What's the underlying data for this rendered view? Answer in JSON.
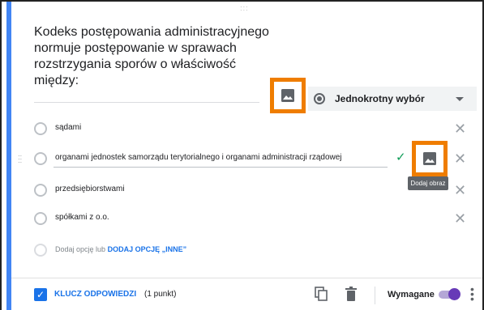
{
  "question": {
    "text": "Kodeks postępowania administracyjnego\nnormuje postępowanie w sprawach\nrozstrzygania sporów o właściwość\nmiędzy:",
    "type_label": "Jednokrotny wybór"
  },
  "options": [
    {
      "label": "sądami"
    },
    {
      "label": "organami jednostek samorządu terytorialnego i organami administracji rządowej"
    },
    {
      "label": "przedsiębiorstwami"
    },
    {
      "label": "spółkami z o.o."
    }
  ],
  "add_option": {
    "label": "Dodaj opcję",
    "or_text": "lub",
    "other_label": "DODAJ OPCJĘ „INNE”"
  },
  "tooltip": "Dodaj obraz",
  "footer": {
    "answer_key_label": "KLUCZ ODPOWIEDZI",
    "points": "(1 punkt)",
    "required_label": "Wymagane"
  },
  "icons": {
    "close": "close-icon",
    "check": "check-icon",
    "image": "image-icon",
    "drag": "drag-handle-icon",
    "copy": "copy-icon",
    "trash": "trash-icon",
    "more": "more-vert-icon"
  },
  "colors": {
    "accent": "#4285f4",
    "highlight": "#ef7d00",
    "link": "#1a73e8",
    "check": "#0f9d58",
    "toggle": "#673ab7"
  }
}
